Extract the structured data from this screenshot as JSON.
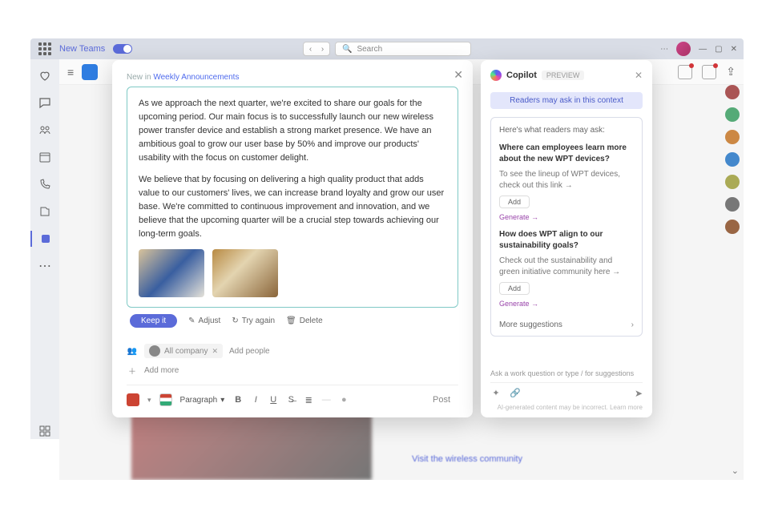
{
  "titlebar": {
    "app_hint": "New Teams",
    "search_placeholder": "Search"
  },
  "compose": {
    "meta_prefix": "New in",
    "meta_link": "Weekly Announcements",
    "para1": "As we approach the next quarter, we're excited to share our goals for the upcoming period. Our main focus is to successfully launch our new wireless power transfer device and establish a strong market presence. We have an ambitious goal to grow our user base by 50% and improve our products' usability with the focus on customer delight.",
    "para2": "We believe that by focusing on delivering a high quality product that adds value to our customers' lives, we can increase brand loyalty and grow our user base. We're committed to continuous improvement and innovation, and we believe that the upcoming quarter will be a crucial step towards achieving our long-term goals.",
    "keep_btn": "Keep it",
    "adjust": "Adjust",
    "tryagain": "Try again",
    "delete": "Delete",
    "audience_chip": "All company",
    "add_people": "Add people",
    "add_more": "Add more",
    "para_style": "Paragraph",
    "post_btn": "Post"
  },
  "copilot": {
    "title": "Copilot",
    "badge": "PREVIEW",
    "context_pill": "Readers may ask in this context",
    "lead": "Here's what readers may ask:",
    "q1": {
      "title": "Where can employees learn more about the new WPT devices?",
      "body": "To see the lineup of WPT devices, check out this link →"
    },
    "q2": {
      "title": "How does WPT align to our sustainability goals?",
      "body": "Check out the sustainability and green initiative community here →"
    },
    "add_btn": "Add",
    "generate": "Generate →",
    "more": "More suggestions",
    "hint": "Ask a work question or type / for suggestions",
    "disclaimer": "AI-generated content may be incorrect. Learn more"
  },
  "backdrop": {
    "community_link": "Visit the wireless community"
  }
}
